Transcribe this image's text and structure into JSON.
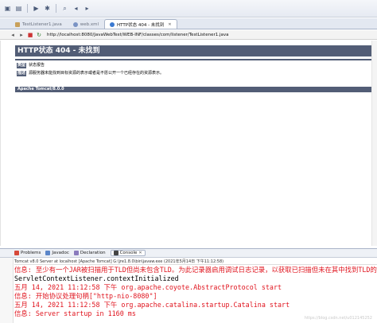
{
  "toolbar": {
    "icons": [
      "new-icon",
      "save-icon",
      "run-icon",
      "debug-icon",
      "search-icon",
      "back-icon",
      "forward-icon"
    ]
  },
  "editor_tabs": [
    {
      "label": "TestListener1.java",
      "active": false,
      "icon": "java-file-icon"
    },
    {
      "label": "web.xml",
      "active": false,
      "icon": "xml-file-icon"
    },
    {
      "label": "HTTP状态 404 - 未找到",
      "active": true,
      "icon": "browser-icon"
    }
  ],
  "browser": {
    "url": "http://localhost:8080/JavaWebTest/WEB-INF/classes/com/listener/TestListener1.java"
  },
  "page": {
    "title": "HTTP状态 404 - 未找到",
    "type_label": "类型",
    "type_value": "状态报告",
    "desc_label": "描述",
    "desc_value": "源服务器未能找到目标资源的表示或者是不愿公开一个已经存在的资源表示。",
    "server": "Apache Tomcat/8.0.0"
  },
  "panel": {
    "tabs": [
      {
        "label": "Problems",
        "active": false
      },
      {
        "label": "Javadoc",
        "active": false
      },
      {
        "label": "Declaration",
        "active": false
      },
      {
        "label": "Console",
        "active": true
      }
    ],
    "status": "Tomcat v8.0 Server at localhost [Apache Tomcat] G:\\jre1.8.0\\bin\\javaw.exe (2021年5月14日 下午11:12:58)"
  },
  "console_lines": [
    {
      "text": "信息: 至少有一个JAR被扫描用于TLD但尚未包含TLD。为此记录器启用调试日志记录，以获取已扫描但未在其中找到TLD的完整JAR列表。在扫描期",
      "color": "red"
    },
    {
      "text": "ServletContextListener.contextInitialized",
      "color": "black"
    },
    {
      "text": "五月 14, 2021 11:12:58 下午 org.apache.coyote.AbstractProtocol start",
      "color": "red"
    },
    {
      "text": "信息: 开始协议处理句柄[\"http-nio-8080\"]",
      "color": "red"
    },
    {
      "text": "五月 14, 2021 11:12:58 下午 org.apache.catalina.startup.Catalina start",
      "color": "red"
    },
    {
      "text": "信息: Server startup in 1160 ms",
      "color": "red"
    }
  ],
  "watermark": "https://blog.csdn.net/u012145252"
}
